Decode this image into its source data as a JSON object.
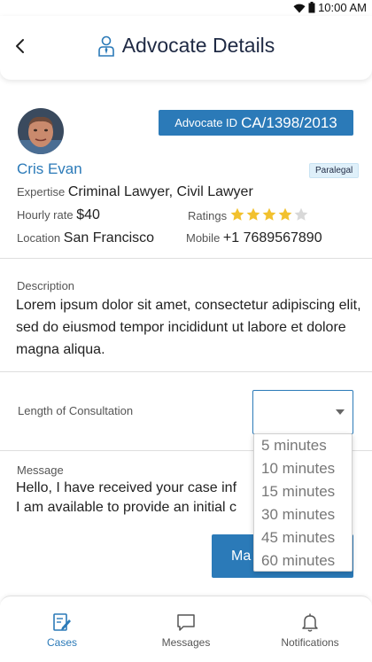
{
  "status_bar": {
    "time": "10:00 AM"
  },
  "header": {
    "title": "Advocate Details"
  },
  "profile": {
    "advocate_id_label": "Advocate ID",
    "advocate_id_value": "CA/1398/2013",
    "name": "Cris Evan",
    "badge": "Paralegal",
    "expertise_label": "Expertise",
    "expertise_value": "Criminal Lawyer, Civil Lawyer",
    "rate_label": "Hourly rate",
    "rate_value": "$40",
    "ratings_label": "Ratings",
    "rating": 4,
    "rating_max": 5,
    "location_label": "Location",
    "location_value": "San Francisco",
    "mobile_label": "Mobile",
    "mobile_value": "+1 7689567890"
  },
  "description": {
    "label": "Description",
    "text": "Lorem ipsum dolor sit amet, consectetur adipiscing elit, sed do eiusmod tempor incididunt ut labore et dolore magna aliqua."
  },
  "consultation": {
    "label": "Length of Consultation",
    "selected": "",
    "options": [
      "5 minutes",
      "10 minutes",
      "15 minutes",
      "30 minutes",
      "45 minutes",
      "60 minutes"
    ]
  },
  "message": {
    "label": "Message",
    "text": "Hello, I have received your case inf\nI am available to provide an initial c"
  },
  "submit_label": "Ma",
  "tabs": [
    {
      "label": "Cases",
      "icon": "cases-icon",
      "active": true
    },
    {
      "label": "Messages",
      "icon": "messages-icon",
      "active": false
    },
    {
      "label": "Notifications",
      "icon": "bell-icon",
      "active": false
    }
  ],
  "colors": {
    "accent": "#2b7ab8",
    "star": "#f2c12e",
    "star_empty": "#d8d8d8"
  }
}
